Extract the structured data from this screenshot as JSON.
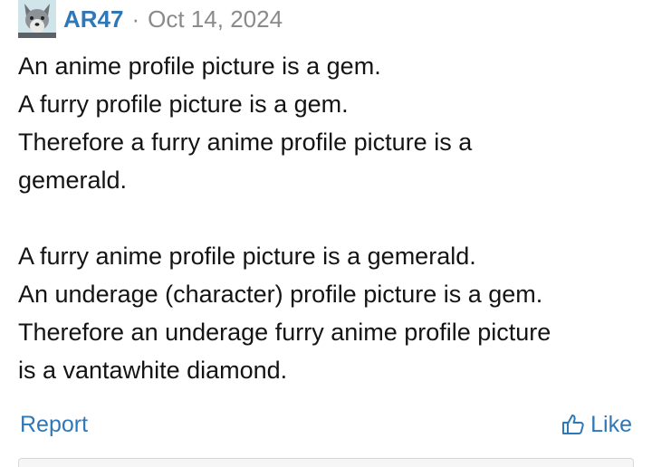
{
  "post": {
    "author": "AR47",
    "separator": "·",
    "date": "Oct 14, 2024",
    "avatar_icon": "wolf-avatar-icon",
    "lines": [
      "An anime profile picture is a gem.",
      "A furry profile picture is a gem.",
      "Therefore a furry anime profile picture is a",
      "gemerald.",
      "A furry anime profile picture is a gemerald.",
      "An underage (character) profile picture is a gem.",
      "Therefore an underage furry anime profile picture",
      "is a vantawhite diamond."
    ]
  },
  "actions": {
    "report_label": "Report",
    "like_label": "Like",
    "like_icon": "thumbs-up-icon"
  },
  "colors": {
    "link": "#2f78b8",
    "meta": "#8a8a8a",
    "text": "#141414"
  }
}
